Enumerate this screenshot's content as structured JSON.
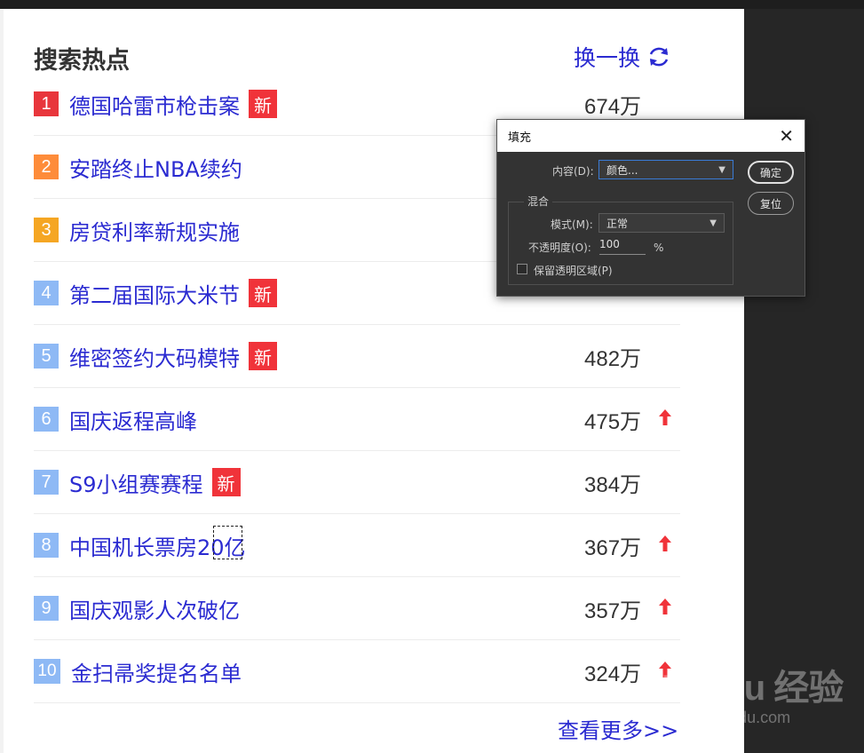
{
  "panel": {
    "title": "搜索热点",
    "refresh_label": "换一换",
    "more_label": "查看更多>>",
    "colors": {
      "link": "#2b2bd1",
      "badge": "#f0333a",
      "rank1": "#e8363c",
      "rank2": "#fe8c3a",
      "rank3": "#f5a623",
      "rank_other": "#8eb9f5"
    }
  },
  "items": [
    {
      "rank": "1",
      "title": "德国哈雷市枪击案",
      "badge": "新",
      "count": "674万",
      "trend": ""
    },
    {
      "rank": "2",
      "title": "安踏终止NBA续约",
      "badge": "",
      "count": "",
      "trend": ""
    },
    {
      "rank": "3",
      "title": "房贷利率新规实施",
      "badge": "",
      "count": "",
      "trend": ""
    },
    {
      "rank": "4",
      "title": "第二届国际大米节",
      "badge": "新",
      "count": "",
      "trend": ""
    },
    {
      "rank": "5",
      "title": "维密签约大码模特",
      "badge": "新",
      "count": "482万",
      "trend": ""
    },
    {
      "rank": "6",
      "title": "国庆返程高峰",
      "badge": "",
      "count": "475万",
      "trend": "up"
    },
    {
      "rank": "7",
      "title": "S9小组赛赛程",
      "badge": "新",
      "count": "384万",
      "trend": ""
    },
    {
      "rank": "8",
      "title": "中国机长票房20亿",
      "badge": "",
      "count": "367万",
      "trend": "up"
    },
    {
      "rank": "9",
      "title": "国庆观影人次破亿",
      "badge": "",
      "count": "357万",
      "trend": "up"
    },
    {
      "rank": "10",
      "title": "金扫帚奖提名名单",
      "badge": "",
      "count": "324万",
      "trend": "up"
    }
  ],
  "dialog": {
    "title": "填充",
    "content_label": "内容(D):",
    "content_value": "颜色...",
    "blend_group_label": "混合",
    "mode_label": "模式(M):",
    "mode_value": "正常",
    "opacity_label": "不透明度(O):",
    "opacity_value": "100",
    "opacity_unit": "%",
    "preserve_label": "保留透明区域(P)",
    "ok_label": "确定",
    "reset_label": "复位"
  },
  "watermark": {
    "logo": "Bai du 经验",
    "url": "jingyan.baidu.com"
  }
}
